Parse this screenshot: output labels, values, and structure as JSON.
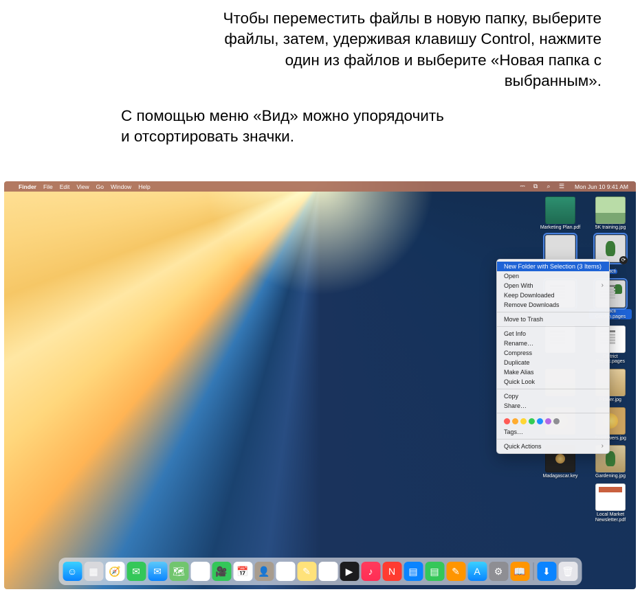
{
  "callouts": {
    "c1": "Чтобы переместить файлы в новую папку, выберите файлы, затем, удерживая клавишу Control, нажмите один из файлов и выберите «Новая папка с выбранным».",
    "c2": "С помощью меню «Вид» можно упорядочить и отсортировать значки."
  },
  "menubar": {
    "items": [
      "Finder",
      "File",
      "Edit",
      "View",
      "Go",
      "Window",
      "Help"
    ],
    "datetime": "Mon Jun 10  9:41 AM"
  },
  "desktop_items": [
    {
      "label": "Marketing Plan.pdf",
      "kind": "pdf",
      "selected": false
    },
    {
      "label": "5K training.jpg",
      "kind": "img1",
      "selected": false
    },
    {
      "label": "",
      "kind": "img2",
      "selected": true
    },
    {
      "label": "Cacti",
      "kind": "img3",
      "selected": true,
      "sync": true
    },
    {
      "label": "",
      "kind": "pages",
      "selected": true
    },
    {
      "label": "Cacti Garden.pages",
      "kind": "pages cacti",
      "selected": true
    },
    {
      "label": "",
      "kind": "pages",
      "selected": false
    },
    {
      "label": "District Report.pages",
      "kind": "pages",
      "selected": false
    },
    {
      "label": "",
      "kind": "img4",
      "selected": false
    },
    {
      "label": "Flower.jpg",
      "kind": "img4",
      "selected": false
    },
    {
      "label": "",
      "kind": "img5",
      "selected": false
    },
    {
      "label": "Sunflowers.jpg",
      "kind": "img5",
      "selected": false
    },
    {
      "label": "Madagascar.key",
      "kind": "key",
      "selected": false
    },
    {
      "label": "Gardening.jpg",
      "kind": "img3",
      "selected": false
    },
    {
      "label": "",
      "kind": "blank",
      "selected": false
    },
    {
      "label": "Local Market Newsletter.pdf",
      "kind": "pdf2",
      "selected": false
    }
  ],
  "context_menu": {
    "groups": [
      [
        {
          "label": "New Folder with Selection (3 Items)",
          "hi": true
        },
        {
          "label": "Open"
        },
        {
          "label": "Open With",
          "arrow": true
        },
        {
          "label": "Keep Downloaded"
        },
        {
          "label": "Remove Downloads"
        }
      ],
      [
        {
          "label": "Move to Trash"
        }
      ],
      [
        {
          "label": "Get Info"
        },
        {
          "label": "Rename…"
        },
        {
          "label": "Compress"
        },
        {
          "label": "Duplicate"
        },
        {
          "label": "Make Alias"
        },
        {
          "label": "Quick Look"
        }
      ],
      [
        {
          "label": "Copy"
        },
        {
          "label": "Share…"
        }
      ],
      [
        {
          "tags": [
            "#ff5b56",
            "#ffac30",
            "#ffd633",
            "#33cc55",
            "#1e8fff",
            "#b267e6",
            "#8e8e93"
          ]
        },
        {
          "label": "Tags…"
        }
      ],
      [
        {
          "label": "Quick Actions",
          "arrow": true
        }
      ]
    ]
  },
  "dock": [
    {
      "name": "finder",
      "bg": "linear-gradient(#3ad0ff,#0a84ff)",
      "glyph": "☺"
    },
    {
      "name": "launchpad",
      "bg": "#d8d8dc",
      "glyph": "▦"
    },
    {
      "name": "safari",
      "bg": "#fff",
      "glyph": "🧭"
    },
    {
      "name": "messages",
      "bg": "#34c759",
      "glyph": "✉"
    },
    {
      "name": "mail",
      "bg": "linear-gradient(#5ac8fa,#0a84ff)",
      "glyph": "✉"
    },
    {
      "name": "maps",
      "bg": "#71c56e",
      "glyph": "🗺"
    },
    {
      "name": "photos",
      "bg": "#fff",
      "glyph": "✿"
    },
    {
      "name": "facetime",
      "bg": "#34c759",
      "glyph": "🎥"
    },
    {
      "name": "calendar",
      "bg": "#fff",
      "glyph": "📅"
    },
    {
      "name": "contacts",
      "bg": "#a89c8e",
      "glyph": "👤"
    },
    {
      "name": "reminders",
      "bg": "#fff",
      "glyph": "☑"
    },
    {
      "name": "notes",
      "bg": "#ffe27a",
      "glyph": "✎"
    },
    {
      "name": "freeform",
      "bg": "#fff",
      "glyph": "✏"
    },
    {
      "name": "tv",
      "bg": "#1c1c1e",
      "glyph": "▶"
    },
    {
      "name": "music",
      "bg": "linear-gradient(#ff3b5c,#ff2d55)",
      "glyph": "♪"
    },
    {
      "name": "news",
      "bg": "#ff3b30",
      "glyph": "N"
    },
    {
      "name": "keynote",
      "bg": "#0a84ff",
      "glyph": "▤"
    },
    {
      "name": "numbers",
      "bg": "#34c759",
      "glyph": "▤"
    },
    {
      "name": "pages",
      "bg": "#ff9500",
      "glyph": "✎"
    },
    {
      "name": "appstore",
      "bg": "linear-gradient(#3ad0ff,#0a84ff)",
      "glyph": "A"
    },
    {
      "name": "settings",
      "bg": "#8e8e93",
      "glyph": "⚙"
    },
    {
      "name": "books",
      "bg": "#ff9500",
      "glyph": "📖"
    }
  ],
  "dock_right": [
    {
      "name": "downloads",
      "bg": "#0a84ff",
      "glyph": "⬇"
    },
    {
      "name": "trash",
      "bg": "#e5e5ea",
      "glyph": "🗑"
    }
  ]
}
